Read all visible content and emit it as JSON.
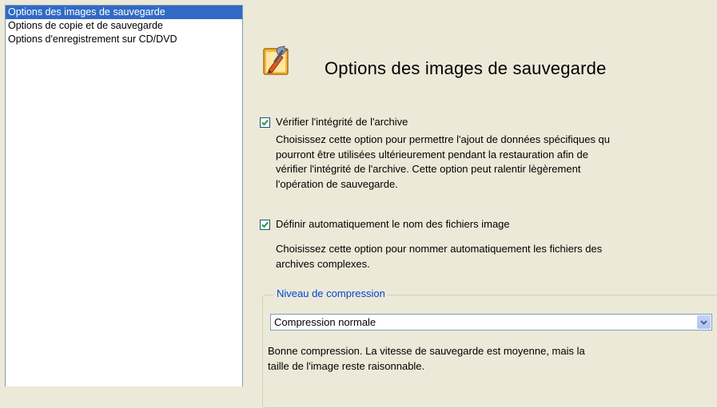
{
  "sidebar": {
    "items": [
      {
        "label": "Options des images de sauvegarde",
        "selected": true
      },
      {
        "label": "Options de copie et de sauvegarde",
        "selected": false
      },
      {
        "label": "Options d'enregistrement sur CD/DVD",
        "selected": false
      }
    ]
  },
  "header": {
    "title": "Options des images de sauvegarde",
    "icon": "settings-wrench-pencil-icon"
  },
  "options": [
    {
      "checked": true,
      "label": "Vérifier l'intégrité de l'archive",
      "description": [
        "Choisissez cette option pour permettre l'ajout de données spécifiques qu",
        "pourront être utilisées ultérieurement pendant la restauration afin de",
        "vérifier l'intégrité de l'archive. Cette option peut ralentir lègèrement",
        "l'opération de sauvegarde."
      ]
    },
    {
      "checked": true,
      "label": "Définir automatiquement le nom des fichiers image",
      "description": [
        "Choisissez cette option pour nommer automatiquement les fichiers des",
        "archives complexes."
      ]
    }
  ],
  "compression": {
    "group_label": "Niveau de compression",
    "selected": "Compression normale",
    "description": [
      "Bonne compression. La vitesse de sauvegarde est moyenne, mais la",
      "taille de l'image reste raisonnable."
    ]
  },
  "colors": {
    "selection": "#316ac5",
    "group_label": "#0046d5",
    "background": "#ece9d8",
    "checkmark": "#21a121"
  }
}
